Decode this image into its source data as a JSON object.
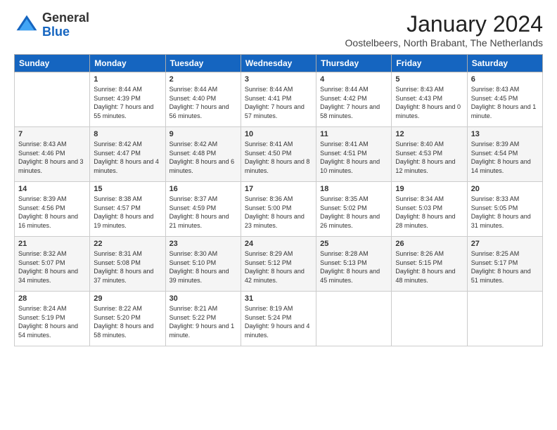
{
  "header": {
    "logo_general": "General",
    "logo_blue": "Blue",
    "month": "January 2024",
    "location": "Oostelbeers, North Brabant, The Netherlands"
  },
  "days_of_week": [
    "Sunday",
    "Monday",
    "Tuesday",
    "Wednesday",
    "Thursday",
    "Friday",
    "Saturday"
  ],
  "weeks": [
    [
      {
        "day": "",
        "sunrise": "",
        "sunset": "",
        "daylight": ""
      },
      {
        "day": "1",
        "sunrise": "Sunrise: 8:44 AM",
        "sunset": "Sunset: 4:39 PM",
        "daylight": "Daylight: 7 hours and 55 minutes."
      },
      {
        "day": "2",
        "sunrise": "Sunrise: 8:44 AM",
        "sunset": "Sunset: 4:40 PM",
        "daylight": "Daylight: 7 hours and 56 minutes."
      },
      {
        "day": "3",
        "sunrise": "Sunrise: 8:44 AM",
        "sunset": "Sunset: 4:41 PM",
        "daylight": "Daylight: 7 hours and 57 minutes."
      },
      {
        "day": "4",
        "sunrise": "Sunrise: 8:44 AM",
        "sunset": "Sunset: 4:42 PM",
        "daylight": "Daylight: 7 hours and 58 minutes."
      },
      {
        "day": "5",
        "sunrise": "Sunrise: 8:43 AM",
        "sunset": "Sunset: 4:43 PM",
        "daylight": "Daylight: 8 hours and 0 minutes."
      },
      {
        "day": "6",
        "sunrise": "Sunrise: 8:43 AM",
        "sunset": "Sunset: 4:45 PM",
        "daylight": "Daylight: 8 hours and 1 minute."
      }
    ],
    [
      {
        "day": "7",
        "sunrise": "Sunrise: 8:43 AM",
        "sunset": "Sunset: 4:46 PM",
        "daylight": "Daylight: 8 hours and 3 minutes."
      },
      {
        "day": "8",
        "sunrise": "Sunrise: 8:42 AM",
        "sunset": "Sunset: 4:47 PM",
        "daylight": "Daylight: 8 hours and 4 minutes."
      },
      {
        "day": "9",
        "sunrise": "Sunrise: 8:42 AM",
        "sunset": "Sunset: 4:48 PM",
        "daylight": "Daylight: 8 hours and 6 minutes."
      },
      {
        "day": "10",
        "sunrise": "Sunrise: 8:41 AM",
        "sunset": "Sunset: 4:50 PM",
        "daylight": "Daylight: 8 hours and 8 minutes."
      },
      {
        "day": "11",
        "sunrise": "Sunrise: 8:41 AM",
        "sunset": "Sunset: 4:51 PM",
        "daylight": "Daylight: 8 hours and 10 minutes."
      },
      {
        "day": "12",
        "sunrise": "Sunrise: 8:40 AM",
        "sunset": "Sunset: 4:53 PM",
        "daylight": "Daylight: 8 hours and 12 minutes."
      },
      {
        "day": "13",
        "sunrise": "Sunrise: 8:39 AM",
        "sunset": "Sunset: 4:54 PM",
        "daylight": "Daylight: 8 hours and 14 minutes."
      }
    ],
    [
      {
        "day": "14",
        "sunrise": "Sunrise: 8:39 AM",
        "sunset": "Sunset: 4:56 PM",
        "daylight": "Daylight: 8 hours and 16 minutes."
      },
      {
        "day": "15",
        "sunrise": "Sunrise: 8:38 AM",
        "sunset": "Sunset: 4:57 PM",
        "daylight": "Daylight: 8 hours and 19 minutes."
      },
      {
        "day": "16",
        "sunrise": "Sunrise: 8:37 AM",
        "sunset": "Sunset: 4:59 PM",
        "daylight": "Daylight: 8 hours and 21 minutes."
      },
      {
        "day": "17",
        "sunrise": "Sunrise: 8:36 AM",
        "sunset": "Sunset: 5:00 PM",
        "daylight": "Daylight: 8 hours and 23 minutes."
      },
      {
        "day": "18",
        "sunrise": "Sunrise: 8:35 AM",
        "sunset": "Sunset: 5:02 PM",
        "daylight": "Daylight: 8 hours and 26 minutes."
      },
      {
        "day": "19",
        "sunrise": "Sunrise: 8:34 AM",
        "sunset": "Sunset: 5:03 PM",
        "daylight": "Daylight: 8 hours and 28 minutes."
      },
      {
        "day": "20",
        "sunrise": "Sunrise: 8:33 AM",
        "sunset": "Sunset: 5:05 PM",
        "daylight": "Daylight: 8 hours and 31 minutes."
      }
    ],
    [
      {
        "day": "21",
        "sunrise": "Sunrise: 8:32 AM",
        "sunset": "Sunset: 5:07 PM",
        "daylight": "Daylight: 8 hours and 34 minutes."
      },
      {
        "day": "22",
        "sunrise": "Sunrise: 8:31 AM",
        "sunset": "Sunset: 5:08 PM",
        "daylight": "Daylight: 8 hours and 37 minutes."
      },
      {
        "day": "23",
        "sunrise": "Sunrise: 8:30 AM",
        "sunset": "Sunset: 5:10 PM",
        "daylight": "Daylight: 8 hours and 39 minutes."
      },
      {
        "day": "24",
        "sunrise": "Sunrise: 8:29 AM",
        "sunset": "Sunset: 5:12 PM",
        "daylight": "Daylight: 8 hours and 42 minutes."
      },
      {
        "day": "25",
        "sunrise": "Sunrise: 8:28 AM",
        "sunset": "Sunset: 5:13 PM",
        "daylight": "Daylight: 8 hours and 45 minutes."
      },
      {
        "day": "26",
        "sunrise": "Sunrise: 8:26 AM",
        "sunset": "Sunset: 5:15 PM",
        "daylight": "Daylight: 8 hours and 48 minutes."
      },
      {
        "day": "27",
        "sunrise": "Sunrise: 8:25 AM",
        "sunset": "Sunset: 5:17 PM",
        "daylight": "Daylight: 8 hours and 51 minutes."
      }
    ],
    [
      {
        "day": "28",
        "sunrise": "Sunrise: 8:24 AM",
        "sunset": "Sunset: 5:19 PM",
        "daylight": "Daylight: 8 hours and 54 minutes."
      },
      {
        "day": "29",
        "sunrise": "Sunrise: 8:22 AM",
        "sunset": "Sunset: 5:20 PM",
        "daylight": "Daylight: 8 hours and 58 minutes."
      },
      {
        "day": "30",
        "sunrise": "Sunrise: 8:21 AM",
        "sunset": "Sunset: 5:22 PM",
        "daylight": "Daylight: 9 hours and 1 minute."
      },
      {
        "day": "31",
        "sunrise": "Sunrise: 8:19 AM",
        "sunset": "Sunset: 5:24 PM",
        "daylight": "Daylight: 9 hours and 4 minutes."
      },
      {
        "day": "",
        "sunrise": "",
        "sunset": "",
        "daylight": ""
      },
      {
        "day": "",
        "sunrise": "",
        "sunset": "",
        "daylight": ""
      },
      {
        "day": "",
        "sunrise": "",
        "sunset": "",
        "daylight": ""
      }
    ]
  ]
}
